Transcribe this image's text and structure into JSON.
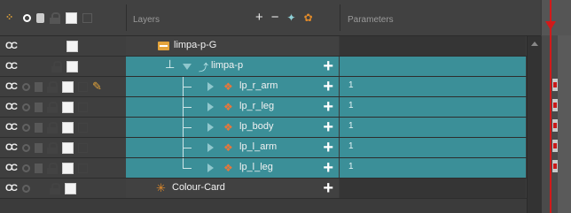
{
  "header": {
    "layers_label": "Layers",
    "parameters_label": "Parameters",
    "tools": [
      "add-layer-icon",
      "delete-layer-icon",
      "add-peg-icon",
      "more-icon"
    ]
  },
  "layers": [
    {
      "name": "limpa-p-G",
      "type": "group",
      "selected": false,
      "param": ""
    },
    {
      "name": "limpa-p",
      "type": "peg",
      "selected": true,
      "param": ""
    },
    {
      "name": "lp_r_arm",
      "type": "drawing",
      "selected": true,
      "param": "1"
    },
    {
      "name": "lp_r_leg",
      "type": "drawing",
      "selected": true,
      "param": "1"
    },
    {
      "name": "lp_body",
      "type": "drawing",
      "selected": true,
      "param": "1"
    },
    {
      "name": "lp_l_arm",
      "type": "drawing",
      "selected": true,
      "param": "1"
    },
    {
      "name": "lp_l_leg",
      "type": "drawing",
      "selected": true,
      "param": "1"
    },
    {
      "name": "Colour-Card",
      "type": "colour-card",
      "selected": false,
      "param": ""
    }
  ],
  "colors": {
    "selected_row": "#3b8f98",
    "folder": "#e3a33b",
    "playhead": "#d11a1a"
  }
}
